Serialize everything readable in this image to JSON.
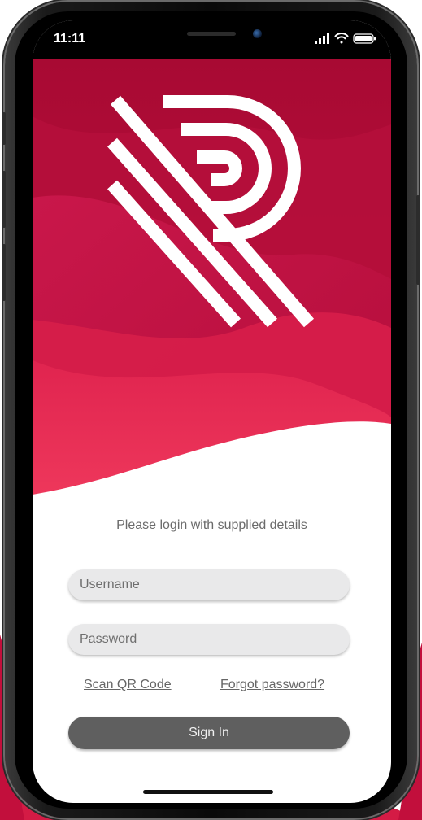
{
  "status_bar": {
    "time": "11:11",
    "icons": [
      "signal-icon",
      "wifi-icon",
      "battery-icon"
    ]
  },
  "brand": {
    "logo_icon": "r-logo-icon",
    "primary_color": "#c4103f",
    "accent_color": "#e8345a"
  },
  "login": {
    "prompt": "Please login with supplied details",
    "username_placeholder": "Username",
    "username_value": "",
    "password_placeholder": "Password",
    "password_value": "",
    "scan_qr_label": "Scan QR Code",
    "forgot_password_label": "Forgot password?",
    "sign_in_label": "Sign In"
  }
}
